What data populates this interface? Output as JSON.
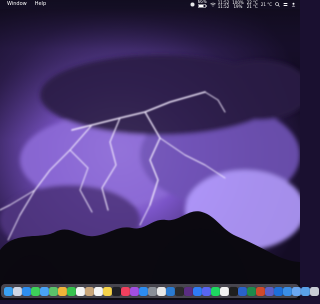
{
  "menubar": {
    "items": [
      "Window",
      "Help"
    ],
    "status": {
      "battery_percent": "66%",
      "time_label_top": "11:52",
      "time_label_bottom": "11:52",
      "small_lines": [
        "100%",
        "19%",
        "22 °C",
        "21 °C",
        "21 °C"
      ]
    },
    "icons": [
      "apple-logo-icon",
      "battery-icon",
      "wifi-icon",
      "search-icon",
      "control-center-icon",
      "user-icon"
    ]
  },
  "desktop": {
    "wallpaper": "purple lightning storm over tree silhouettes"
  },
  "dock": {
    "apps": [
      {
        "name": "finder-icon",
        "color": "#3aa0f2"
      },
      {
        "name": "launchpad-icon",
        "color": "#cfd6e6"
      },
      {
        "name": "safari-icon",
        "color": "#2e8ef0"
      },
      {
        "name": "messages-icon",
        "color": "#3ed05a"
      },
      {
        "name": "mail-icon",
        "color": "#4aa3f7"
      },
      {
        "name": "maps-icon",
        "color": "#5bc26a"
      },
      {
        "name": "photos-icon",
        "color": "#f0b43a"
      },
      {
        "name": "facetime-icon",
        "color": "#38c24f"
      },
      {
        "name": "calendar-icon",
        "color": "#f4f4f4"
      },
      {
        "name": "contacts-icon",
        "color": "#c9a67a"
      },
      {
        "name": "reminders-icon",
        "color": "#f4f4f4"
      },
      {
        "name": "notes-icon",
        "color": "#f6d34a"
      },
      {
        "name": "tv-icon",
        "color": "#1f1f24"
      },
      {
        "name": "music-icon",
        "color": "#f0405e"
      },
      {
        "name": "podcasts-icon",
        "color": "#a24fe0"
      },
      {
        "name": "app-store-icon",
        "color": "#2d8cf0"
      },
      {
        "name": "settings-icon",
        "color": "#8a8f98"
      },
      {
        "name": "chrome-icon",
        "color": "#e8e8e8"
      },
      {
        "name": "vscode-icon",
        "color": "#2b7bd1"
      },
      {
        "name": "terminal-icon",
        "color": "#2a2a2a"
      },
      {
        "name": "slack-icon",
        "color": "#5a2d82"
      },
      {
        "name": "zoom-icon",
        "color": "#2f7cf6"
      },
      {
        "name": "discord-icon",
        "color": "#5865f2"
      },
      {
        "name": "spotify-icon",
        "color": "#1ed760"
      },
      {
        "name": "notion-icon",
        "color": "#f2f2f2"
      },
      {
        "name": "figma-icon",
        "color": "#1f1f1f"
      },
      {
        "name": "word-icon",
        "color": "#2a62c9"
      },
      {
        "name": "excel-icon",
        "color": "#1f8a4c"
      },
      {
        "name": "powerpoint-icon",
        "color": "#d04a2a"
      },
      {
        "name": "teams-icon",
        "color": "#5b5fc7"
      },
      {
        "name": "outlook-icon",
        "color": "#1d6fd8"
      },
      {
        "name": "onedrive-icon",
        "color": "#3a8ee6"
      },
      {
        "name": "preview-icon",
        "color": "#6aa7f0"
      },
      {
        "name": "downloads-icon",
        "color": "#5aa0e8"
      },
      {
        "name": "trash-icon",
        "color": "#c8ccd4"
      }
    ]
  }
}
